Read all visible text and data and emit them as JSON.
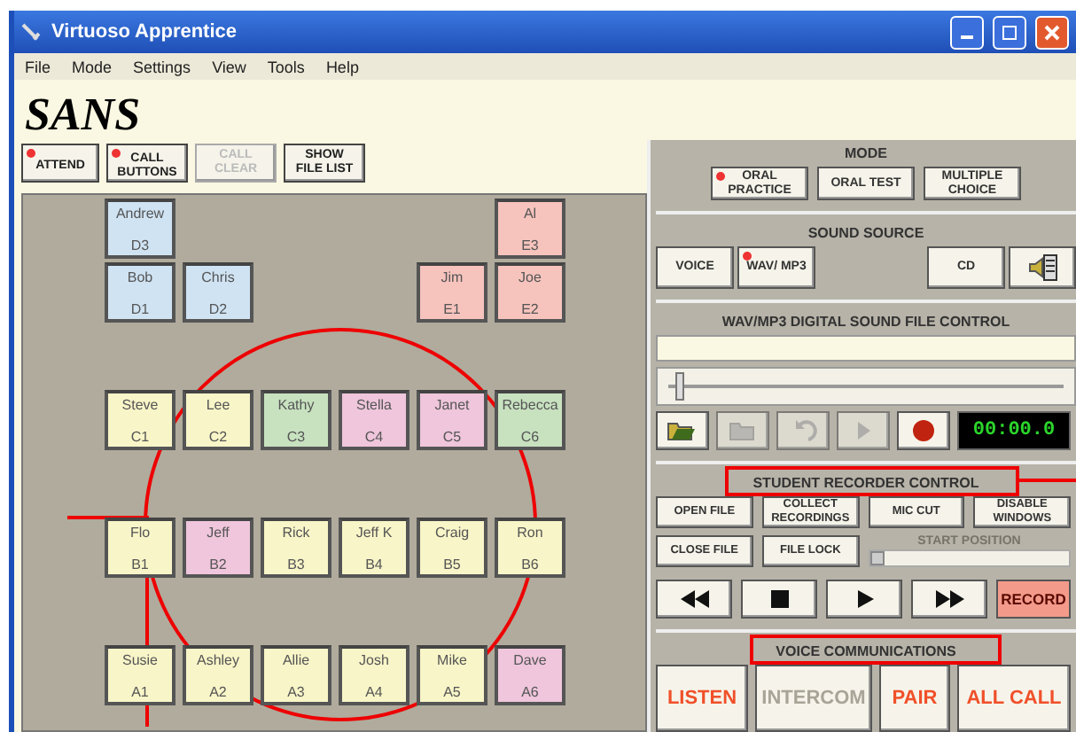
{
  "window": {
    "title": "Virtuoso Apprentice"
  },
  "menu": [
    "File",
    "Mode",
    "Settings",
    "View",
    "Tools",
    "Help"
  ],
  "class_title": "SANS",
  "toolbar": [
    {
      "label": "ATTEND",
      "indicator": true,
      "disabled": false
    },
    {
      "label": "CALL BUTTONS",
      "indicator": true,
      "disabled": false
    },
    {
      "label": "CALL CLEAR",
      "indicator": false,
      "disabled": true
    },
    {
      "label": "SHOW FILE LIST",
      "indicator": false,
      "disabled": false
    }
  ],
  "seating": {
    "sections": [
      {
        "rows": [
          {
            "seats": [
              {
                "kind": "student",
                "name": "Andrew",
                "code": "D3",
                "color": "#cfe3f3"
              },
              {
                "kind": "empty"
              },
              {
                "kind": "empty"
              },
              {
                "kind": "empty"
              },
              {
                "kind": "empty"
              },
              {
                "kind": "student",
                "name": "Al",
                "code": "E3",
                "color": "#f6c3bd"
              }
            ]
          },
          {
            "seats": [
              {
                "kind": "student",
                "name": "Bob",
                "code": "D1",
                "color": "#cfe3f3"
              },
              {
                "kind": "student",
                "name": "Chris",
                "code": "D2",
                "color": "#cfe3f3"
              },
              {
                "kind": "empty"
              },
              {
                "kind": "empty"
              },
              {
                "kind": "student",
                "name": "Jim",
                "code": "E1",
                "color": "#f6c3bd"
              },
              {
                "kind": "student",
                "name": "Joe",
                "code": "E2",
                "color": "#f6c3bd"
              }
            ]
          }
        ]
      },
      {
        "rows": [
          {
            "seats": [
              {
                "kind": "student",
                "name": "Steve",
                "code": "C1",
                "color": "#f8f5c8"
              },
              {
                "kind": "student",
                "name": "Lee",
                "code": "C2",
                "color": "#f8f5c8"
              },
              {
                "kind": "student",
                "name": "Kathy",
                "code": "C3",
                "color": "#c8e2c0"
              },
              {
                "kind": "student",
                "name": "Stella",
                "code": "C4",
                "color": "#efc6dc"
              },
              {
                "kind": "student",
                "name": "Janet",
                "code": "C5",
                "color": "#efc6dc"
              },
              {
                "kind": "student",
                "name": "Rebecca",
                "code": "C6",
                "color": "#c8e2c0"
              }
            ]
          }
        ]
      },
      {
        "rows": [
          {
            "seats": [
              {
                "kind": "student",
                "name": "Flo",
                "code": "B1",
                "color": "#f8f5c8"
              },
              {
                "kind": "student",
                "name": "Jeff",
                "code": "B2",
                "color": "#efc6dc"
              },
              {
                "kind": "student",
                "name": "Rick",
                "code": "B3",
                "color": "#f8f5c8"
              },
              {
                "kind": "student",
                "name": "Jeff K",
                "code": "B4",
                "color": "#f8f5c8"
              },
              {
                "kind": "student",
                "name": "Craig",
                "code": "B5",
                "color": "#f8f5c8"
              },
              {
                "kind": "student",
                "name": "Ron",
                "code": "B6",
                "color": "#f8f5c8"
              }
            ]
          }
        ]
      },
      {
        "rows": [
          {
            "seats": [
              {
                "kind": "student",
                "name": "Susie",
                "code": "A1",
                "color": "#f8f5c8"
              },
              {
                "kind": "student",
                "name": "Ashley",
                "code": "A2",
                "color": "#f8f5c8"
              },
              {
                "kind": "student",
                "name": "Allie",
                "code": "A3",
                "color": "#f8f5c8"
              },
              {
                "kind": "student",
                "name": "Josh",
                "code": "A4",
                "color": "#f8f5c8"
              },
              {
                "kind": "student",
                "name": "Mike",
                "code": "A5",
                "color": "#f8f5c8"
              },
              {
                "kind": "student",
                "name": "Dave",
                "code": "A6",
                "color": "#efc6dc"
              }
            ]
          }
        ]
      }
    ]
  },
  "mode": {
    "title": "MODE",
    "options": [
      {
        "label": "ORAL PRACTICE",
        "selected": true
      },
      {
        "label": "ORAL TEST",
        "selected": false
      },
      {
        "label": "MULTIPLE CHOICE",
        "selected": false
      }
    ]
  },
  "sound_source": {
    "title": "SOUND SOURCE",
    "options": [
      {
        "kind": "text",
        "label": "VOICE",
        "selected": false
      },
      {
        "kind": "text",
        "label": "WAV/ MP3",
        "selected": true
      },
      {
        "kind": "text",
        "label": "CD",
        "selected": false
      },
      {
        "kind": "speaker",
        "selected": false
      }
    ]
  },
  "file_control": {
    "title": "WAV/MP3 DIGITAL SOUND FILE CONTROL",
    "position": {
      "level": 0.02
    },
    "buttons": [
      {
        "kind": "open",
        "disabled": false
      },
      {
        "kind": "folder",
        "disabled": true
      },
      {
        "kind": "undo",
        "disabled": true
      },
      {
        "kind": "play",
        "disabled": true
      },
      {
        "kind": "record",
        "disabled": false
      }
    ],
    "time": "00:00.0"
  },
  "recorder": {
    "title": "STUDENT RECORDER CONTROL",
    "buttons": [
      {
        "label": "OPEN FILE"
      },
      {
        "label": "COLLECT RECORDINGS"
      },
      {
        "label": "MIC CUT"
      },
      {
        "label": "DISABLE WINDOWS"
      },
      {
        "label": "CLOSE FILE"
      },
      {
        "label": "FILE LOCK"
      }
    ],
    "start_position": {
      "label": "START POSITION",
      "disabled": true,
      "level": 0
    },
    "transport": [
      {
        "kind": "rewind"
      },
      {
        "kind": "stop"
      },
      {
        "kind": "play"
      },
      {
        "kind": "fast_forward"
      },
      {
        "kind": "record",
        "label": "RECORD"
      }
    ]
  },
  "voice": {
    "title": "VOICE COMMUNICATIONS",
    "buttons": [
      {
        "label": "LISTEN",
        "disabled": false
      },
      {
        "label": "INTERCOM",
        "disabled": true
      },
      {
        "label": "PAIR",
        "disabled": false
      },
      {
        "label": "ALL CALL",
        "disabled": false
      }
    ]
  }
}
